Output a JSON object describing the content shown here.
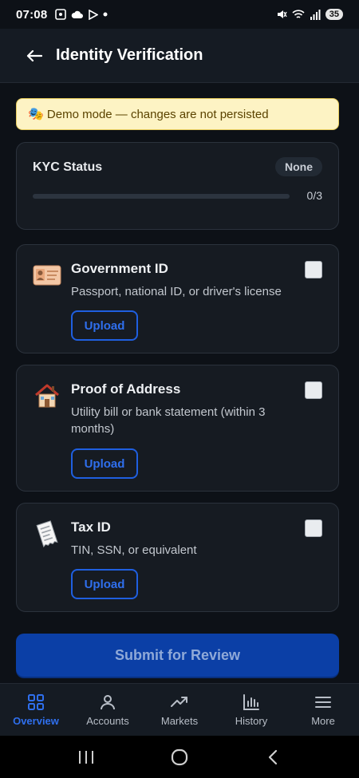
{
  "status_bar": {
    "time": "07:08",
    "battery": "35"
  },
  "header": {
    "title": "Identity Verification",
    "back_icon": "arrow-left-icon"
  },
  "banner": {
    "icon": "masks-icon",
    "text": "Demo mode — changes are not persisted"
  },
  "kyc": {
    "label": "KYC Status",
    "badge": "None",
    "progress_text": "0/3",
    "progress_fraction": 0
  },
  "documents": [
    {
      "icon": "id-card-icon",
      "title": "Government ID",
      "description": "Passport, national ID, or driver's license",
      "upload_label": "Upload",
      "checked": false
    },
    {
      "icon": "house-icon",
      "title": "Proof of Address",
      "description": "Utility bill or bank statement (within 3 months)",
      "upload_label": "Upload",
      "checked": false
    },
    {
      "icon": "receipt-icon",
      "title": "Tax ID",
      "description": "TIN, SSN, or equivalent",
      "upload_label": "Upload",
      "checked": false
    }
  ],
  "submit_label": "Submit for Review",
  "nav": {
    "items": [
      {
        "label": "Overview",
        "icon": "grid-icon",
        "active": true
      },
      {
        "label": "Accounts",
        "icon": "person-icon",
        "active": false
      },
      {
        "label": "Markets",
        "icon": "trend-icon",
        "active": false
      },
      {
        "label": "History",
        "icon": "bar-chart-icon",
        "active": false
      },
      {
        "label": "More",
        "icon": "menu-icon",
        "active": false
      }
    ]
  },
  "colors": {
    "background": "#0d1117",
    "card": "#161b22",
    "accent": "#2f6fed",
    "banner_bg": "#fdf3c4"
  }
}
